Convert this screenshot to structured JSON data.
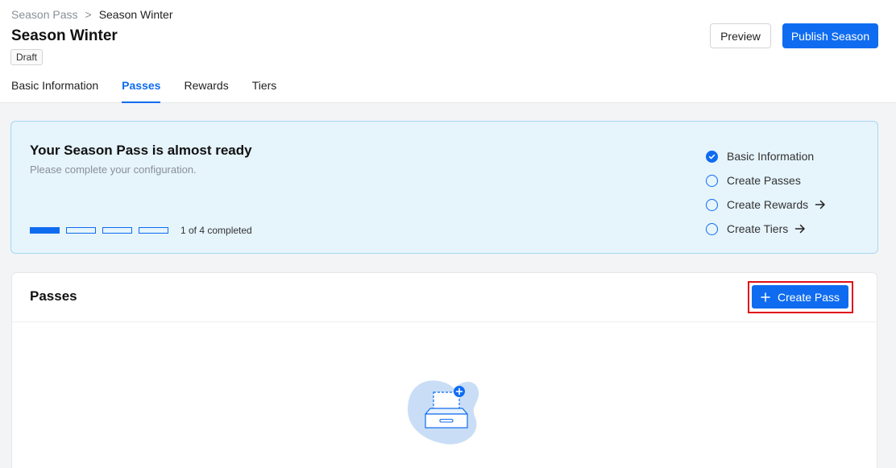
{
  "breadcrumb": {
    "parent": "Season Pass",
    "separator": ">",
    "current": "Season Winter"
  },
  "page": {
    "title": "Season Winter",
    "status": "Draft"
  },
  "actions": {
    "preview_label": "Preview",
    "publish_label": "Publish Season"
  },
  "tabs": [
    {
      "label": "Basic Information",
      "active": false
    },
    {
      "label": "Passes",
      "active": true
    },
    {
      "label": "Rewards",
      "active": false
    },
    {
      "label": "Tiers",
      "active": false
    }
  ],
  "progress": {
    "title": "Your Season Pass is almost ready",
    "subtitle": "Please complete your configuration.",
    "completed": 1,
    "total": 4,
    "status_text": "1 of 4 completed",
    "steps": [
      {
        "label": "Basic Information",
        "done": true,
        "icon": "check-circle-icon"
      },
      {
        "label": "Create Passes",
        "done": false,
        "icon": "circle-icon"
      },
      {
        "label": "Create Rewards",
        "done": false,
        "icon": "circle-icon",
        "arrow": "arrow-right-icon"
      },
      {
        "label": "Create Tiers",
        "done": false,
        "icon": "circle-icon",
        "arrow": "arrow-right-icon"
      }
    ]
  },
  "passes": {
    "title": "Passes",
    "create_label": "Create Pass",
    "create_icon": "plus-icon",
    "empty_illustration": "empty-box-add-icon"
  },
  "colors": {
    "primary": "#0f6cf0",
    "progress_bg": "#e6f4fc",
    "progress_border": "#a8d8f0",
    "highlight": "#e0101a",
    "page_bg": "#f3f4f6"
  }
}
